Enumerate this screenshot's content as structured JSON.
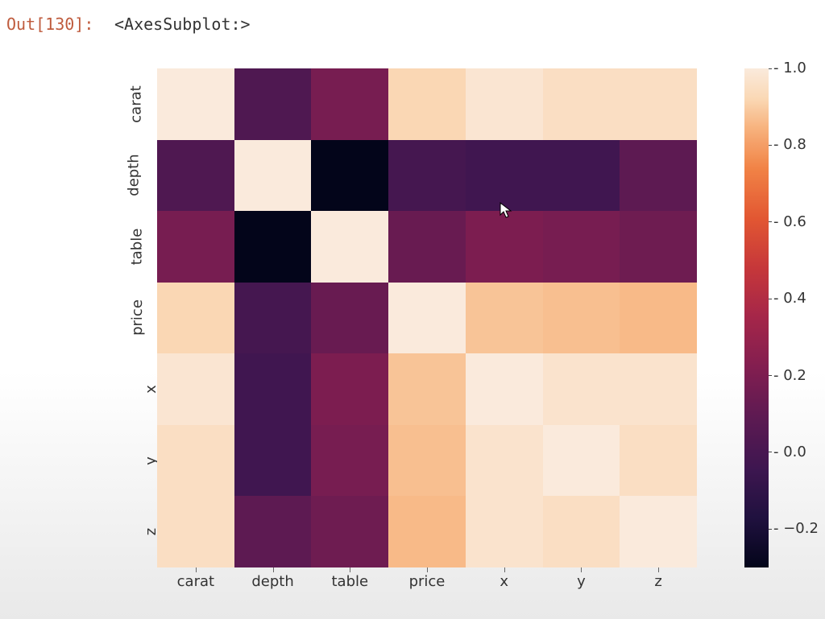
{
  "cell": {
    "prompt": "Out[130]:",
    "repr": "<AxesSubplot:>"
  },
  "chart_data": {
    "type": "heatmap",
    "title": "",
    "xlabel": "",
    "ylabel": "",
    "categories": [
      "carat",
      "depth",
      "table",
      "price",
      "x",
      "y",
      "z"
    ],
    "matrix": [
      [
        1.0,
        0.03,
        0.18,
        0.92,
        0.98,
        0.95,
        0.95
      ],
      [
        0.03,
        1.0,
        -0.3,
        -0.01,
        -0.03,
        -0.03,
        0.09
      ],
      [
        0.18,
        -0.3,
        1.0,
        0.13,
        0.2,
        0.18,
        0.15
      ],
      [
        0.92,
        -0.01,
        0.13,
        1.0,
        0.88,
        0.87,
        0.86
      ],
      [
        0.98,
        -0.03,
        0.2,
        0.88,
        1.0,
        0.97,
        0.97
      ],
      [
        0.95,
        -0.03,
        0.18,
        0.87,
        0.97,
        1.0,
        0.95
      ],
      [
        0.95,
        0.09,
        0.15,
        0.86,
        0.97,
        0.95,
        1.0
      ]
    ],
    "vmin": -0.3,
    "vmax": 1.0,
    "colorbar_ticks": [
      {
        "value": 1.0,
        "label": "1.0"
      },
      {
        "value": 0.8,
        "label": "0.8"
      },
      {
        "value": 0.6,
        "label": "0.6"
      },
      {
        "value": 0.4,
        "label": "0.4"
      },
      {
        "value": 0.2,
        "label": "0.2"
      },
      {
        "value": 0.0,
        "label": "0.0"
      },
      {
        "value": -0.2,
        "label": "−0.2"
      }
    ],
    "colormap": "rocket"
  }
}
